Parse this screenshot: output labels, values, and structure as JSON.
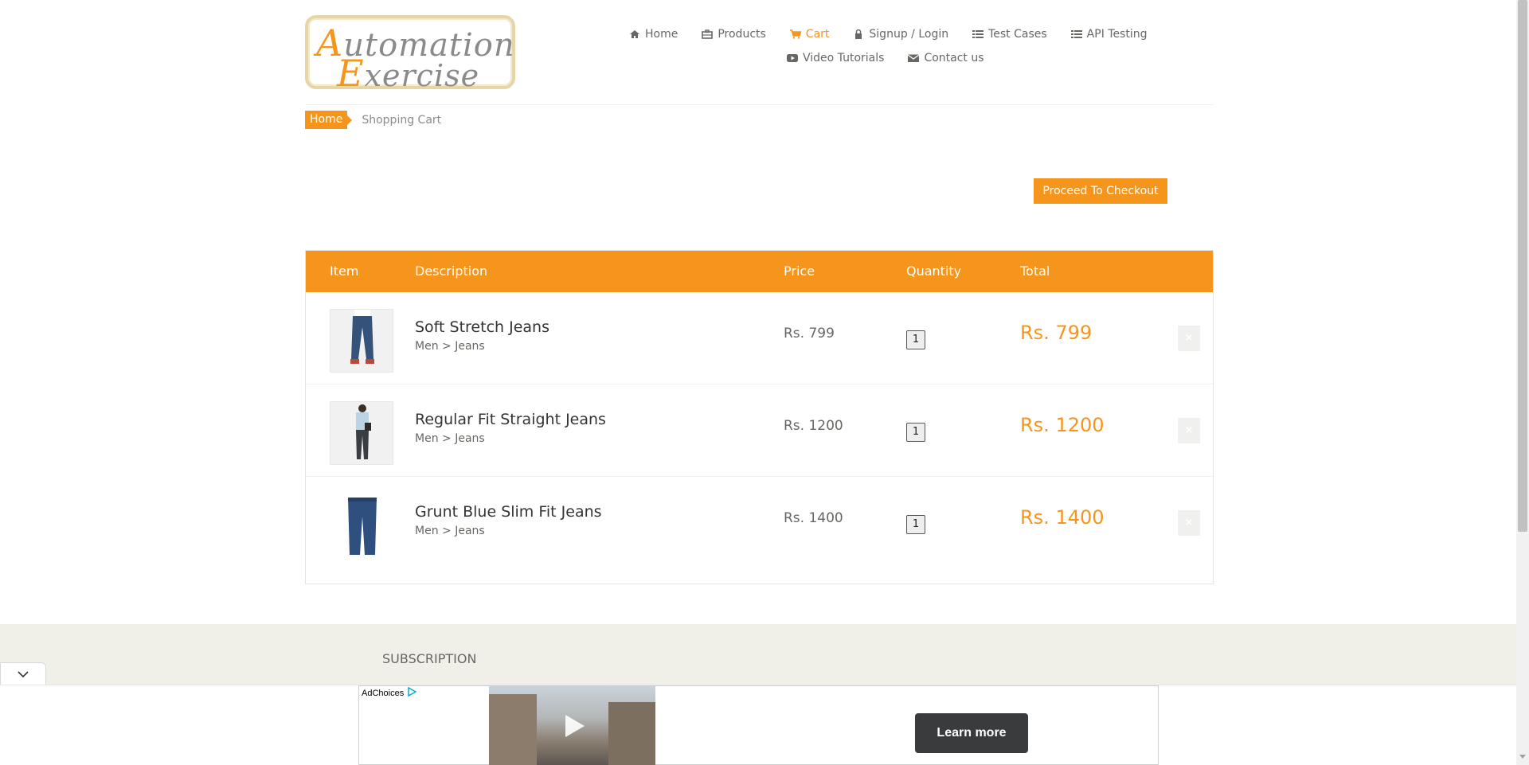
{
  "logo": {
    "line1_cap": "A",
    "line1_rest": "utomation",
    "line2_cap": "E",
    "line2_rest": "xercise"
  },
  "nav": {
    "items": [
      {
        "label": "Home",
        "icon": "home-icon"
      },
      {
        "label": "Products",
        "icon": "briefcase-icon"
      },
      {
        "label": "Cart",
        "icon": "cart-icon"
      },
      {
        "label": "Signup / Login",
        "icon": "lock-icon"
      },
      {
        "label": "Test Cases",
        "icon": "list-icon"
      },
      {
        "label": "API Testing",
        "icon": "list-icon"
      },
      {
        "label": "Video Tutorials",
        "icon": "youtube-icon"
      },
      {
        "label": "Contact us",
        "icon": "envelope-icon"
      }
    ]
  },
  "breadcrumb": {
    "home": "Home",
    "current": "Shopping Cart"
  },
  "checkout_label": "Proceed To Checkout",
  "cart": {
    "headers": [
      "Item",
      "Description",
      "Price",
      "Quantity",
      "Total"
    ],
    "rows": [
      {
        "name": "Soft Stretch Jeans",
        "category": "Men > Jeans",
        "price": "Rs. 799",
        "quantity": "1",
        "total": "Rs. 799",
        "delete": "×"
      },
      {
        "name": "Regular Fit Straight Jeans",
        "category": "Men > Jeans",
        "price": "Rs. 1200",
        "quantity": "1",
        "total": "Rs. 1200",
        "delete": "×"
      },
      {
        "name": "Grunt Blue Slim Fit Jeans",
        "category": "Men > Jeans",
        "price": "Rs. 1400",
        "quantity": "1",
        "total": "Rs. 1400",
        "delete": "×"
      }
    ]
  },
  "footer": {
    "subscription": "SUBSCRIPTION"
  },
  "ad": {
    "adchoices": "AdChoices",
    "learn_more": "Learn more"
  },
  "colors": {
    "accent": "#f6951c",
    "text": "#696763",
    "footer_bg": "#f0f0e9"
  }
}
